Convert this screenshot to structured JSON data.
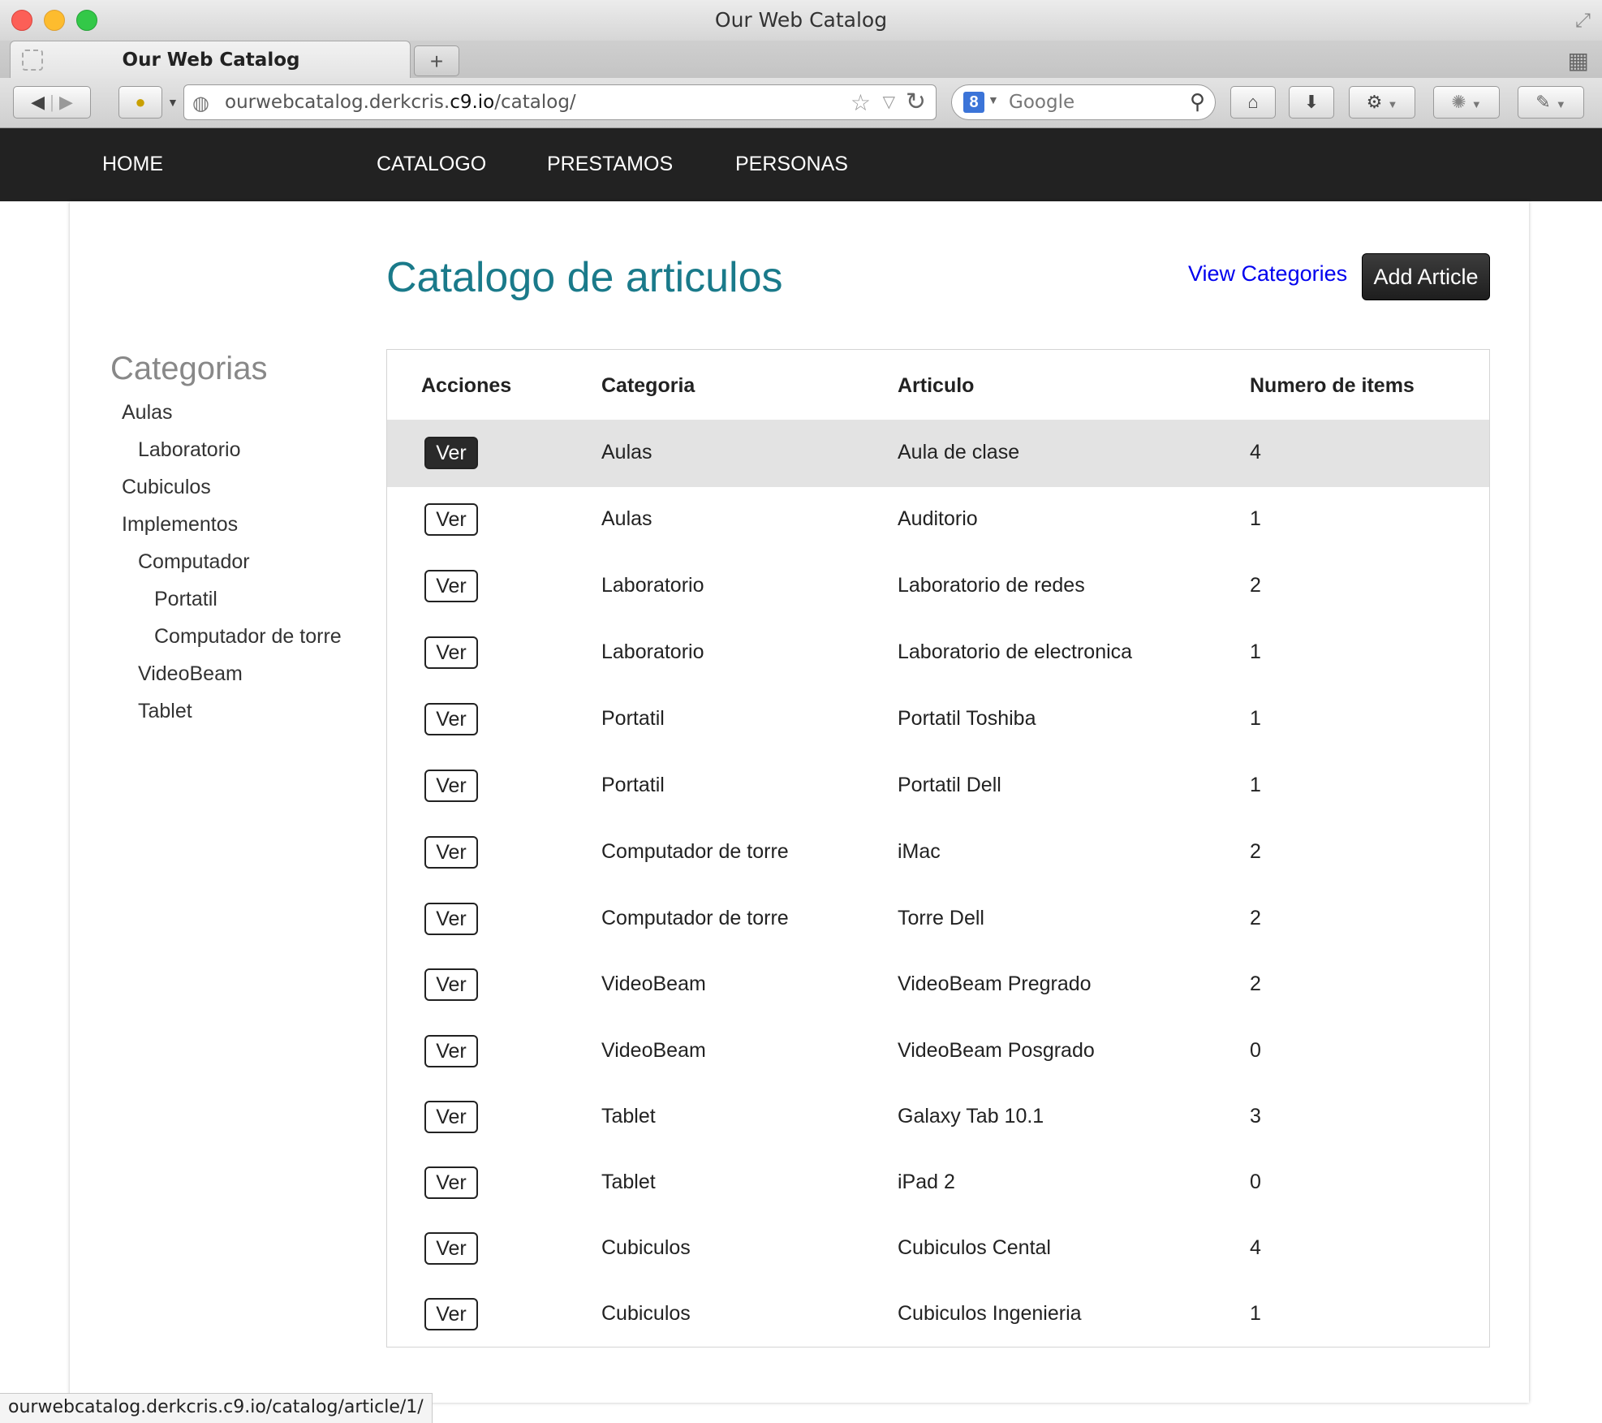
{
  "window": {
    "title": "Our Web Catalog"
  },
  "browser": {
    "tab_title": "Our Web Catalog",
    "new_tab": "+",
    "url_prefix": "ourwebcatalog.derkcris.",
    "url_domain": "c9.io",
    "url_suffix": "/catalog/",
    "search_placeholder": "Google",
    "search_engine_letter": "8"
  },
  "nav": {
    "home": "HOME",
    "catalogo": "CATALOGO",
    "prestamos": "PRESTAMOS",
    "personas": "PERSONAS"
  },
  "sidebar": {
    "title": "Categorias",
    "items": [
      {
        "label": "Aulas",
        "level": 0
      },
      {
        "label": "Laboratorio",
        "level": 1
      },
      {
        "label": "Cubiculos",
        "level": 0
      },
      {
        "label": "Implementos",
        "level": 0
      },
      {
        "label": "Computador",
        "level": 1
      },
      {
        "label": "Portatil",
        "level": 2
      },
      {
        "label": "Computador de torre",
        "level": 2
      },
      {
        "label": "VideoBeam",
        "level": 1
      },
      {
        "label": "Tablet",
        "level": 1
      }
    ]
  },
  "main": {
    "title": "Catalogo de articulos",
    "view_categories": "View Categories",
    "add_article": "Add Article"
  },
  "table": {
    "headers": [
      "Acciones",
      "Categoria",
      "Articulo",
      "Numero de items"
    ],
    "action_label": "Ver",
    "rows": [
      {
        "categoria": "Aulas",
        "articulo": "Aula de clase",
        "items": "4"
      },
      {
        "categoria": "Aulas",
        "articulo": "Auditorio",
        "items": "1"
      },
      {
        "categoria": "Laboratorio",
        "articulo": "Laboratorio de redes",
        "items": "2"
      },
      {
        "categoria": "Laboratorio",
        "articulo": "Laboratorio de electronica",
        "items": "1"
      },
      {
        "categoria": "Portatil",
        "articulo": "Portatil Toshiba",
        "items": "1"
      },
      {
        "categoria": "Portatil",
        "articulo": "Portatil Dell",
        "items": "1"
      },
      {
        "categoria": "Computador de torre",
        "articulo": "iMac",
        "items": "2"
      },
      {
        "categoria": "Computador de torre",
        "articulo": "Torre Dell",
        "items": "2"
      },
      {
        "categoria": "VideoBeam",
        "articulo": "VideoBeam Pregrado",
        "items": "2"
      },
      {
        "categoria": "VideoBeam",
        "articulo": "VideoBeam Posgrado",
        "items": "0"
      },
      {
        "categoria": "Tablet",
        "articulo": "Galaxy Tab 10.1",
        "items": "3"
      },
      {
        "categoria": "Tablet",
        "articulo": "iPad 2",
        "items": "0"
      },
      {
        "categoria": "Cubiculos",
        "articulo": "Cubiculos Cental",
        "items": "4"
      },
      {
        "categoria": "Cubiculos",
        "articulo": "Cubiculos Ingenieria",
        "items": "1"
      }
    ]
  },
  "status_bar": {
    "url": "ourwebcatalog.derkcris.c9.io/catalog/article/1/"
  },
  "colors": {
    "title_teal": "#1a7a8a",
    "nav_bg": "#222222",
    "link_blue": "#0000ee",
    "row_highlight": "#e3e3e3"
  }
}
